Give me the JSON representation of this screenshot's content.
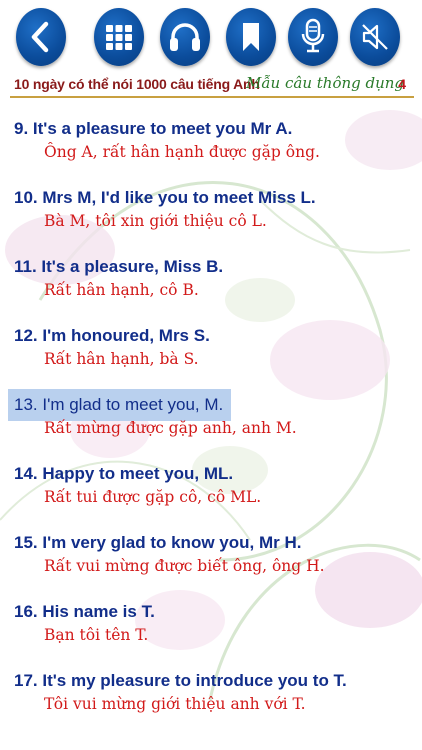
{
  "toolbar": {
    "buttons": [
      {
        "name": "back-button",
        "icon": "chevron-left-icon"
      },
      {
        "name": "menu-grid-button",
        "icon": "grid-icon"
      },
      {
        "name": "listen-button",
        "icon": "headphones-icon"
      },
      {
        "name": "bookmark-button",
        "icon": "bookmark-icon"
      },
      {
        "name": "record-button",
        "icon": "microphone-icon"
      },
      {
        "name": "mute-button",
        "icon": "speaker-mute-icon"
      }
    ],
    "colors": {
      "button": "#0b4c9b",
      "icon": "#ffffff"
    }
  },
  "header": {
    "title": "10 ngày có thể nói 1000 câu tiếng Anh",
    "subtitle": "Mẫu câu thông dụng",
    "page": "4"
  },
  "items": [
    {
      "en": "9.  It's a pleasure to meet you Mr A.",
      "vi": "Ông A, rất hân hạnh được gặp ông."
    },
    {
      "en": "10. Mrs M, I'd like you to meet Miss L.",
      "vi": "Bà M, tôi xin giới thiệu cô L."
    },
    {
      "en": "11. It's a pleasure, Miss B.",
      "vi": "Rất hân hạnh, cô B."
    },
    {
      "en": "12. I'm honoured, Mrs S.",
      "vi": "Rất hân hạnh, bà S."
    },
    {
      "en": "13. I'm glad to meet you, M.",
      "vi": "Rất mừng được gặp anh, anh M.",
      "selected": true
    },
    {
      "en": "14. Happy to meet you, ML.",
      "vi": "Rất tui được gặp cô, cô ML."
    },
    {
      "en": "15. I'm very glad to know you, Mr H.",
      "vi": "Rất vui mừng được biết ông, ông H."
    },
    {
      "en": "16. His name is T.",
      "vi": "Bạn tôi tên T."
    },
    {
      "en": "17. It's my pleasure to introduce you to T.",
      "vi": "Tôi vui mừng giới thiệu anh với T."
    }
  ],
  "colors": {
    "english": "#122e8a",
    "vietnamese": "#d21a1a",
    "highlight": "#b9d0ee",
    "title": "#8a1a1a",
    "subtitle": "#2a7a2a"
  }
}
